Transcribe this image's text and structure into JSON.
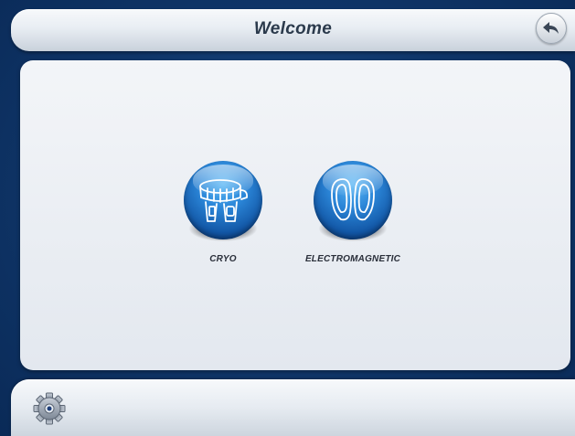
{
  "header": {
    "title": "Welcome",
    "back_icon": "back-arrow-icon"
  },
  "apps": [
    {
      "label": "CRYO",
      "icon": "cryo-applicator-icon"
    },
    {
      "label": "ELECTROMAGNETIC",
      "icon": "footprints-icon"
    }
  ],
  "footer": {
    "settings_icon": "gear-icon"
  },
  "colors": {
    "background": "#0f3568",
    "panel": "#e8ecf2",
    "button_blue": "#1f6fc4",
    "title_text": "#2b3a4c"
  }
}
